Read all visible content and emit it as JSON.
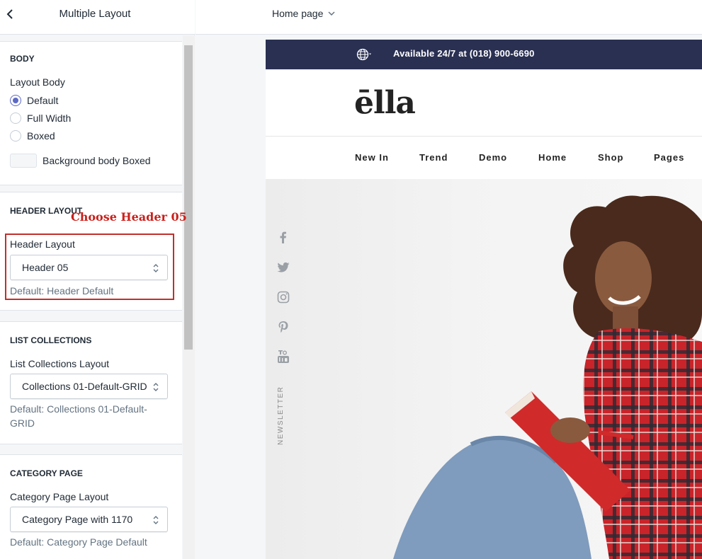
{
  "sidebar": {
    "title": "Multiple Layout",
    "sections": {
      "body": {
        "title": "BODY",
        "label": "Layout Body",
        "options": [
          {
            "label": "Default",
            "checked": true
          },
          {
            "label": "Full Width",
            "checked": false
          },
          {
            "label": "Boxed",
            "checked": false
          }
        ],
        "swatch_label": "Background body Boxed"
      },
      "header": {
        "title": "HEADER LAYOUT",
        "annotation": "Choose Header 05",
        "label": "Header Layout",
        "value": "Header 05",
        "help": "Default: Header Default"
      },
      "collections": {
        "title": "LIST COLLECTIONS",
        "label": "List Collections Layout",
        "value": "Collections 01-Default-GRID",
        "help": "Default: Collections 01-Default-GRID"
      },
      "category": {
        "title": "CATEGORY PAGE",
        "label": "Category Page Layout",
        "value": "Category Page with 1170",
        "help": "Default: Category Page Default"
      }
    }
  },
  "topbar": {
    "page_selector": "Home page"
  },
  "preview": {
    "announcement": "Available 24/7 at (018) 900-6690",
    "logo": "ēlla",
    "nav": [
      "New In",
      "Trend",
      "Demo",
      "Home",
      "Shop",
      "Pages"
    ],
    "social_icons": [
      "facebook-icon",
      "twitter-icon",
      "instagram-icon",
      "pinterest-icon",
      "youtube-icon"
    ],
    "newsletter": "NEWSLETTER"
  },
  "colors": {
    "accent": "#5c6ac4",
    "announcement_bg": "#2a3052",
    "annotation_red": "#c0302b",
    "shirt_red": "#c8242a"
  }
}
